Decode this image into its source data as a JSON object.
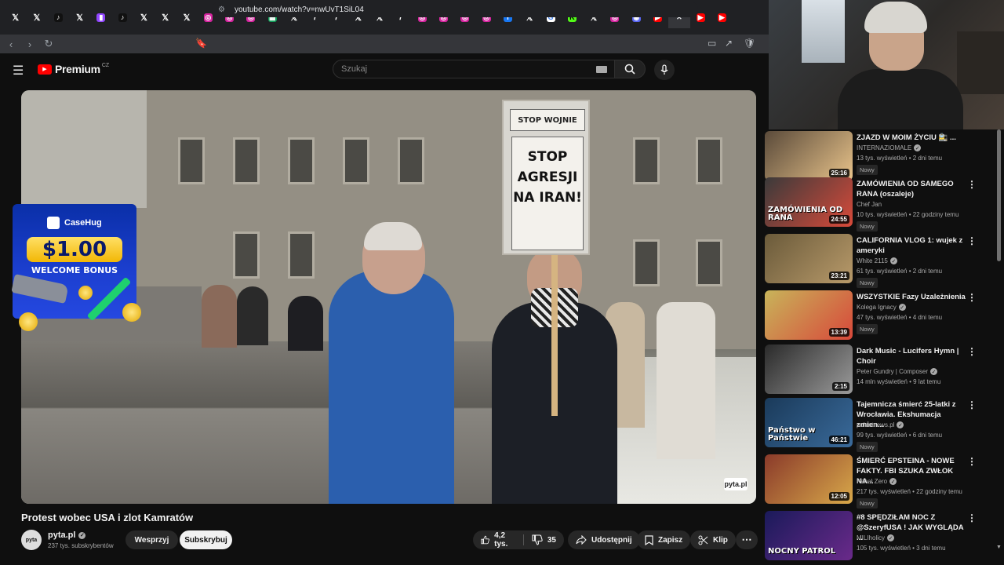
{
  "browser": {
    "tabs": [
      "X",
      "X",
      "TikTok",
      "X",
      "Twitch",
      "TikTok",
      "X",
      "X",
      "X",
      "Instagram",
      "Instagram",
      "Instagram",
      "Sheets",
      "X",
      "F",
      "F",
      "X",
      "X",
      "F",
      "Instagram",
      "Instagram",
      "Instagram",
      "Instagram",
      "Facebook",
      "X",
      "Google",
      "Kick",
      "X",
      "Instagram",
      "Discord",
      "YouTube",
      "active",
      "YouTube",
      "YouTube"
    ],
    "url": "youtube.com/watch?v=nwUvT1SiL04"
  },
  "header": {
    "logo_text": "Premium",
    "country": "CZ",
    "search_placeholder": "Szukaj"
  },
  "video": {
    "sign_top": "STOP WOJNIE",
    "sign_main": "STOP AGRESJI NA IRAN!",
    "watermark": "pyta.pl"
  },
  "ad": {
    "brand": "CaseHug",
    "price": "$1.00",
    "bonus": "WELCOME BONUS"
  },
  "meta": {
    "title": "Protest wobec USA i zlot Kamratów",
    "channel": "pyta.pl",
    "avatar_text": "pyta",
    "subscribers": "237 tys. subskrybentów",
    "support": "Wesprzyj",
    "subscribe": "Subskrybuj",
    "likes": "4,2 tys.",
    "dislikes": "35",
    "share": "Udostępnij",
    "save": "Zapisz",
    "clip": "Klip"
  },
  "recommendations": [
    {
      "title": "ZJAZD W MOIM ŻYCIU 🚉 ...",
      "channel": "INTERNAZIOMALE",
      "meta": "13 tys. wyświetleń • 2 dni temu",
      "duration": "25:16",
      "badge": "Nowy",
      "thumb_text": "",
      "colors": [
        "#5a4a3a",
        "#e8c38a"
      ]
    },
    {
      "title": "ZAMÓWIENIA OD SAMEGO RANA (oszaleje)",
      "channel": "Chef Jan",
      "meta": "10 tys. wyświetleń • 22 godziny temu",
      "duration": "24:55",
      "badge": "Nowy",
      "thumb_text": "ZAMÓWIENIA OD RANA",
      "colors": [
        "#3a3a3a",
        "#d84a3a"
      ]
    },
    {
      "title": "CALIFORNIA VLOG 1: wujek z ameryki",
      "channel": "White 2115",
      "meta": "61 tys. wyświetleń • 2 dni temu",
      "duration": "23:21",
      "badge": "Nowy",
      "thumb_text": "",
      "colors": [
        "#6a5a3a",
        "#b89a6a"
      ]
    },
    {
      "title": "WSZYSTKIE Fazy Uzależnienia",
      "channel": "Kolega Ignacy",
      "meta": "47 tys. wyświetleń • 4 dni temu",
      "duration": "13:39",
      "badge": "Nowy",
      "thumb_text": "",
      "colors": [
        "#c8b45a",
        "#d8483a"
      ]
    },
    {
      "title": "Dark Music - Lucifers Hymn | Choir",
      "channel": "Peter Gundry | Composer",
      "meta": "14 mln wyświetleń • 9 lat temu",
      "duration": "2:15",
      "badge": "",
      "thumb_text": "",
      "colors": [
        "#2a2a2a",
        "#9a9a9a"
      ]
    },
    {
      "title": "Tajemnicza śmierć 25-latki z Wrocławia. Ekshumacja zmien...",
      "channel": "polsatnews.pl",
      "meta": "99 tys. wyświetleń • 6 dni temu",
      "duration": "46:21",
      "badge": "Nowy",
      "thumb_text": "Państwo w Państwie",
      "colors": [
        "#1a3a5a",
        "#3a6a9a"
      ]
    },
    {
      "title": "ŚMIERĆ EPSTEINA - NOWE FAKTY. FBI SZUKA ZWŁOK NA...",
      "channel": "Kanał Zero",
      "meta": "217 tys. wyświetleń • 22 godziny temu",
      "duration": "12:05",
      "badge": "Nowy",
      "thumb_text": "",
      "colors": [
        "#8a3a2a",
        "#d8a84a"
      ]
    },
    {
      "title": "#8 SPĘDZIŁAM NOC Z @SzeryfUSA ! JAK WYGLĄDA ...",
      "channel": "MILIholicy",
      "meta": "105 tys. wyświetleń • 3 dni temu",
      "duration": "",
      "badge": "",
      "thumb_text": "NOCNY PATROL",
      "colors": [
        "#1a1a5a",
        "#6a2a8a"
      ]
    }
  ]
}
